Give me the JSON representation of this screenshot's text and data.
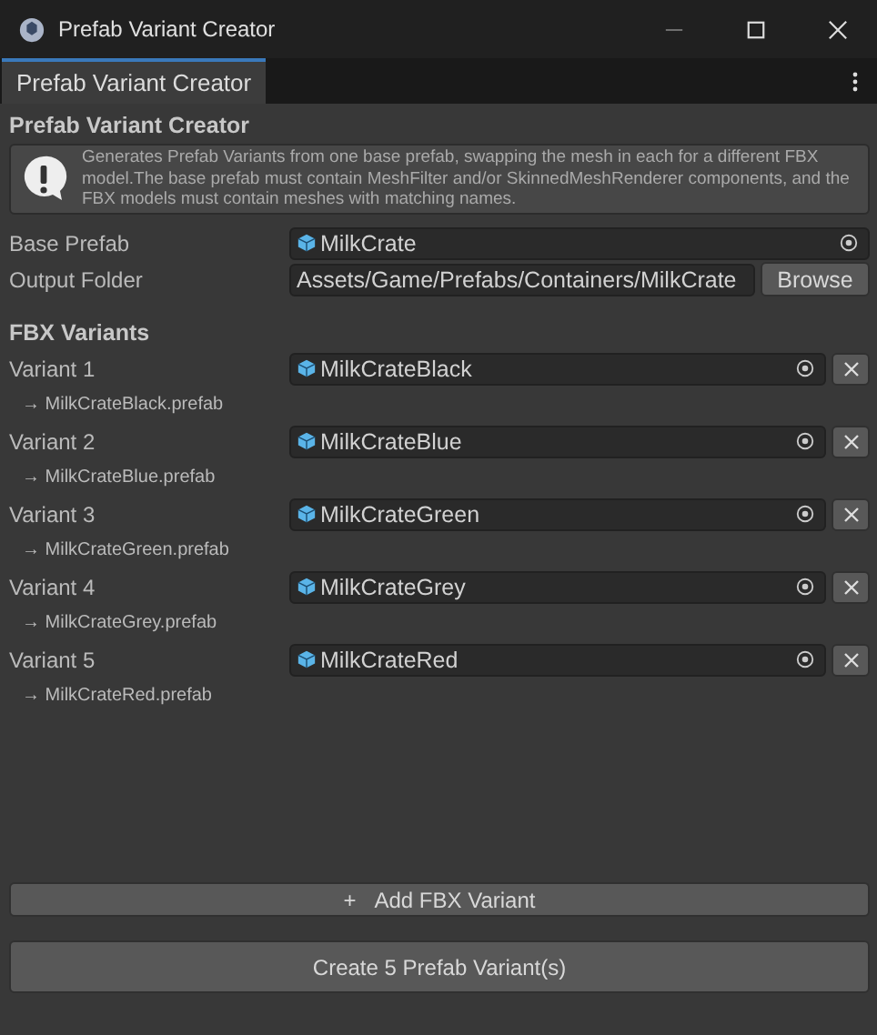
{
  "window": {
    "title": "Prefab Variant Creator"
  },
  "tabs": [
    {
      "label": "Prefab Variant Creator",
      "selected": true
    }
  ],
  "heading": "Prefab Variant Creator",
  "help_box": {
    "text": "Generates Prefab Variants from one base prefab, swapping the mesh in each for a different FBX model.The base prefab must contain MeshFilter and/or SkinnedMeshRenderer components, and the FBX models must contain meshes with matching names."
  },
  "base_prefab": {
    "label": "Base Prefab",
    "value": "MilkCrate"
  },
  "output_folder": {
    "label": "Output Folder",
    "value": "Assets/Game/Prefabs/Containers/MilkCrate",
    "button": "Browse"
  },
  "variants_heading": "FBX Variants",
  "variants": [
    {
      "label": "Variant 1",
      "value": "MilkCrateBlack",
      "output": "→ MilkCrateBlack.prefab"
    },
    {
      "label": "Variant 2",
      "value": "MilkCrateBlue",
      "output": "→ MilkCrateBlue.prefab"
    },
    {
      "label": "Variant 3",
      "value": "MilkCrateGreen",
      "output": "→ MilkCrateGreen.prefab"
    },
    {
      "label": "Variant 4",
      "value": "MilkCrateGrey",
      "output": "→ MilkCrateGrey.prefab"
    },
    {
      "label": "Variant 5",
      "value": "MilkCrateRed",
      "output": "→ MilkCrateRed.prefab"
    }
  ],
  "add_button": {
    "icon": "+",
    "label": "Add FBX Variant"
  },
  "create_button": "Create 5 Prefab Variant(s)"
}
